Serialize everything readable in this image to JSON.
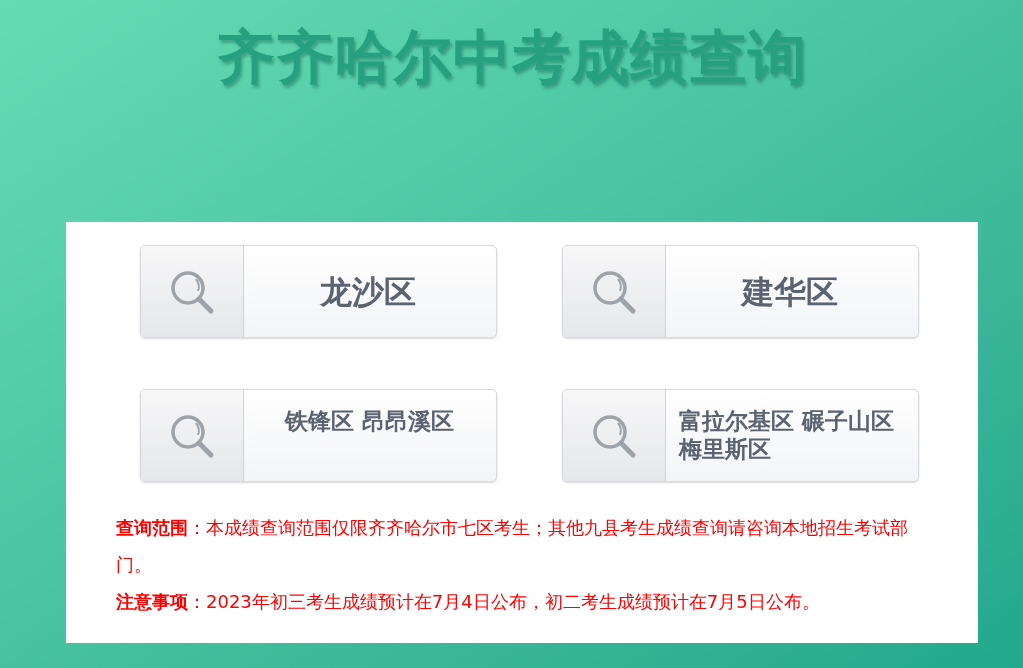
{
  "title": "齐齐哈尔中考成绩查询",
  "buttons": [
    {
      "label": "龙沙区"
    },
    {
      "label": "建华区"
    },
    {
      "label": "铁锋区 昂昂溪区"
    },
    {
      "label": "富拉尔基区 碾子山区梅里斯区"
    }
  ],
  "notes": [
    {
      "label": "查询范围",
      "text": "：本成绩查询范围仅限齐齐哈尔市七区考生；其他九县考生成绩查询请咨询本地招生考试部门。"
    },
    {
      "label": "注意事项",
      "text": "：2023年初三考生成绩预计在7月4日公布，初二考生成绩预计在7月5日公布。"
    }
  ]
}
